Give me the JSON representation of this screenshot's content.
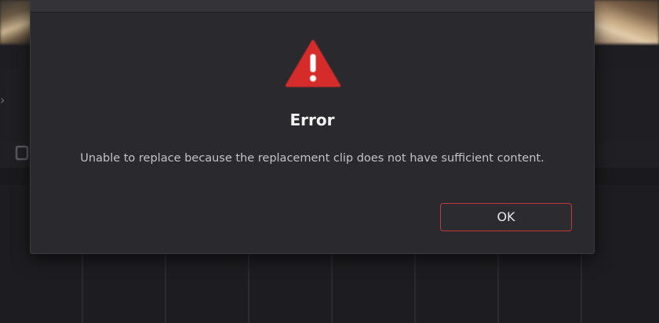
{
  "dialog": {
    "title": "Error",
    "message": "Unable to replace because the replacement clip does not have sufficient content.",
    "ok_label": "OK",
    "icon": "warning-icon"
  },
  "background": {
    "chevron_glyph": "›"
  },
  "colors": {
    "warning_red": "#d52b2b",
    "button_border": "#c0393b",
    "dialog_bg": "#2a2a2e",
    "app_bg": "#1b1b1e"
  }
}
